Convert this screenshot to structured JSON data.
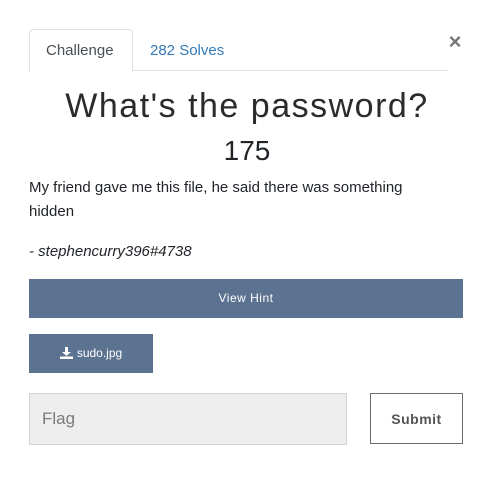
{
  "modal": {
    "close_symbol": "×",
    "tabs": [
      {
        "label": "Challenge",
        "active": true
      },
      {
        "label": "282 Solves",
        "active": false
      }
    ]
  },
  "challenge": {
    "title": "What's the password?",
    "points": "175",
    "description": "My friend gave me this file, he said there was something hidden",
    "author": "- stephencurry396#4738"
  },
  "buttons": {
    "hint_label": "View Hint",
    "file_label": "sudo.jpg",
    "file_icon": "download-icon",
    "submit_label": "Submit"
  },
  "flag_input": {
    "placeholder": "Flag",
    "value": ""
  },
  "colors": {
    "button_bg": "#5c7291",
    "tab_link": "#337ab7"
  }
}
